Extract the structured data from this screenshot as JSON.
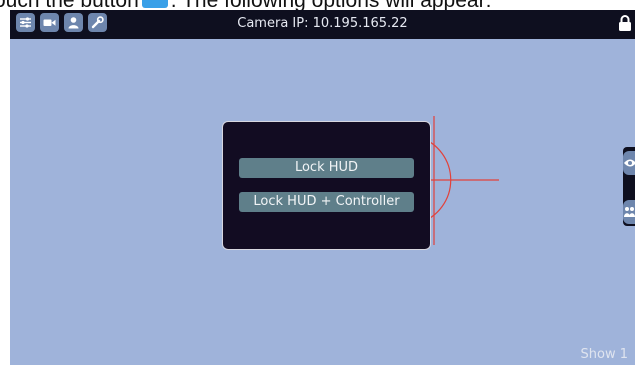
{
  "doc_caption": {
    "before": "ouch the button",
    "after": ". The following options will appear:"
  },
  "topbar": {
    "camera_ip": "Camera IP: 10.195.165.22",
    "buttons": [
      {
        "icon": "settings-sliders-icon"
      },
      {
        "icon": "video-camera-icon"
      },
      {
        "icon": "user-icon"
      },
      {
        "icon": "wrench-icon"
      }
    ],
    "lock_icon": "lock-icon"
  },
  "lock_menu": {
    "options": [
      {
        "label": "Lock HUD"
      },
      {
        "label": "Lock HUD + Controller"
      }
    ]
  },
  "side_panel": {
    "icons": [
      "eye-icon",
      "users-icon"
    ]
  },
  "show": {
    "label": "Show 1"
  },
  "colors": {
    "background": "#9fb3da",
    "topbar": "#0e0f1f",
    "button": "#6e86ad",
    "panel": "#120c22",
    "menu_button": "#5f7f8a",
    "crosshair": "#e2413a"
  }
}
